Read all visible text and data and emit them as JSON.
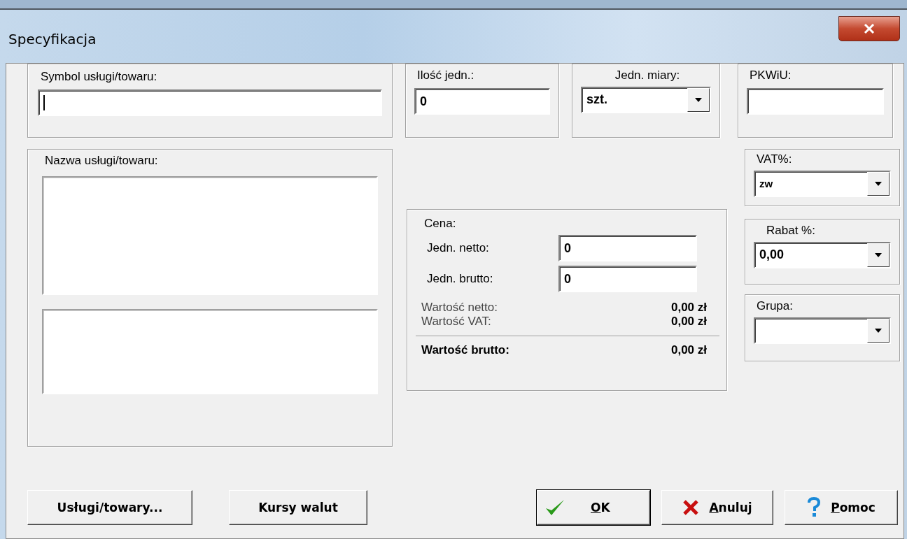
{
  "window": {
    "title": "Specyfikacja"
  },
  "symbol": {
    "label": "Symbol usługi/towaru:",
    "focused": true
  },
  "quantity": {
    "label": "Ilość jedn.:",
    "value": "0"
  },
  "unit": {
    "label": "Jedn. miary:",
    "value": "szt."
  },
  "pkwiu": {
    "label": "PKWiU:"
  },
  "name": {
    "label": "Nazwa usługi/towaru:"
  },
  "vat": {
    "label": "VAT%:",
    "value": "zw"
  },
  "price": {
    "title": "Cena:",
    "inputs": [
      {
        "label": "Jedn. netto:",
        "value": "0"
      },
      {
        "label": "Jedn. brutto:",
        "value": "0"
      }
    ],
    "totals": [
      {
        "label": "Wartość netto:",
        "value": "0,00 zł",
        "emphasis": false
      },
      {
        "label": "Wartość VAT:",
        "value": "0,00 zł",
        "emphasis": false
      },
      {
        "label": "Wartość brutto:",
        "value": "0,00 zł",
        "emphasis": true
      }
    ]
  },
  "discount": {
    "label": "Rabat %:",
    "value": "0,00"
  },
  "group": {
    "label": "Grupa:"
  },
  "buttons": [
    {
      "label": "Usługi/towary...",
      "kind": "plain",
      "default": false,
      "underline_first": false
    },
    {
      "label": "Kursy walut",
      "kind": "plain",
      "default": false,
      "underline_first": false
    },
    {
      "label": "OK",
      "kind": "confirm",
      "default": true,
      "underline_first": true
    },
    {
      "label": "Anuluj",
      "kind": "cancel",
      "default": false,
      "underline_first": true
    },
    {
      "label": "Pomoc",
      "kind": "help",
      "default": false,
      "underline_first": true
    }
  ]
}
